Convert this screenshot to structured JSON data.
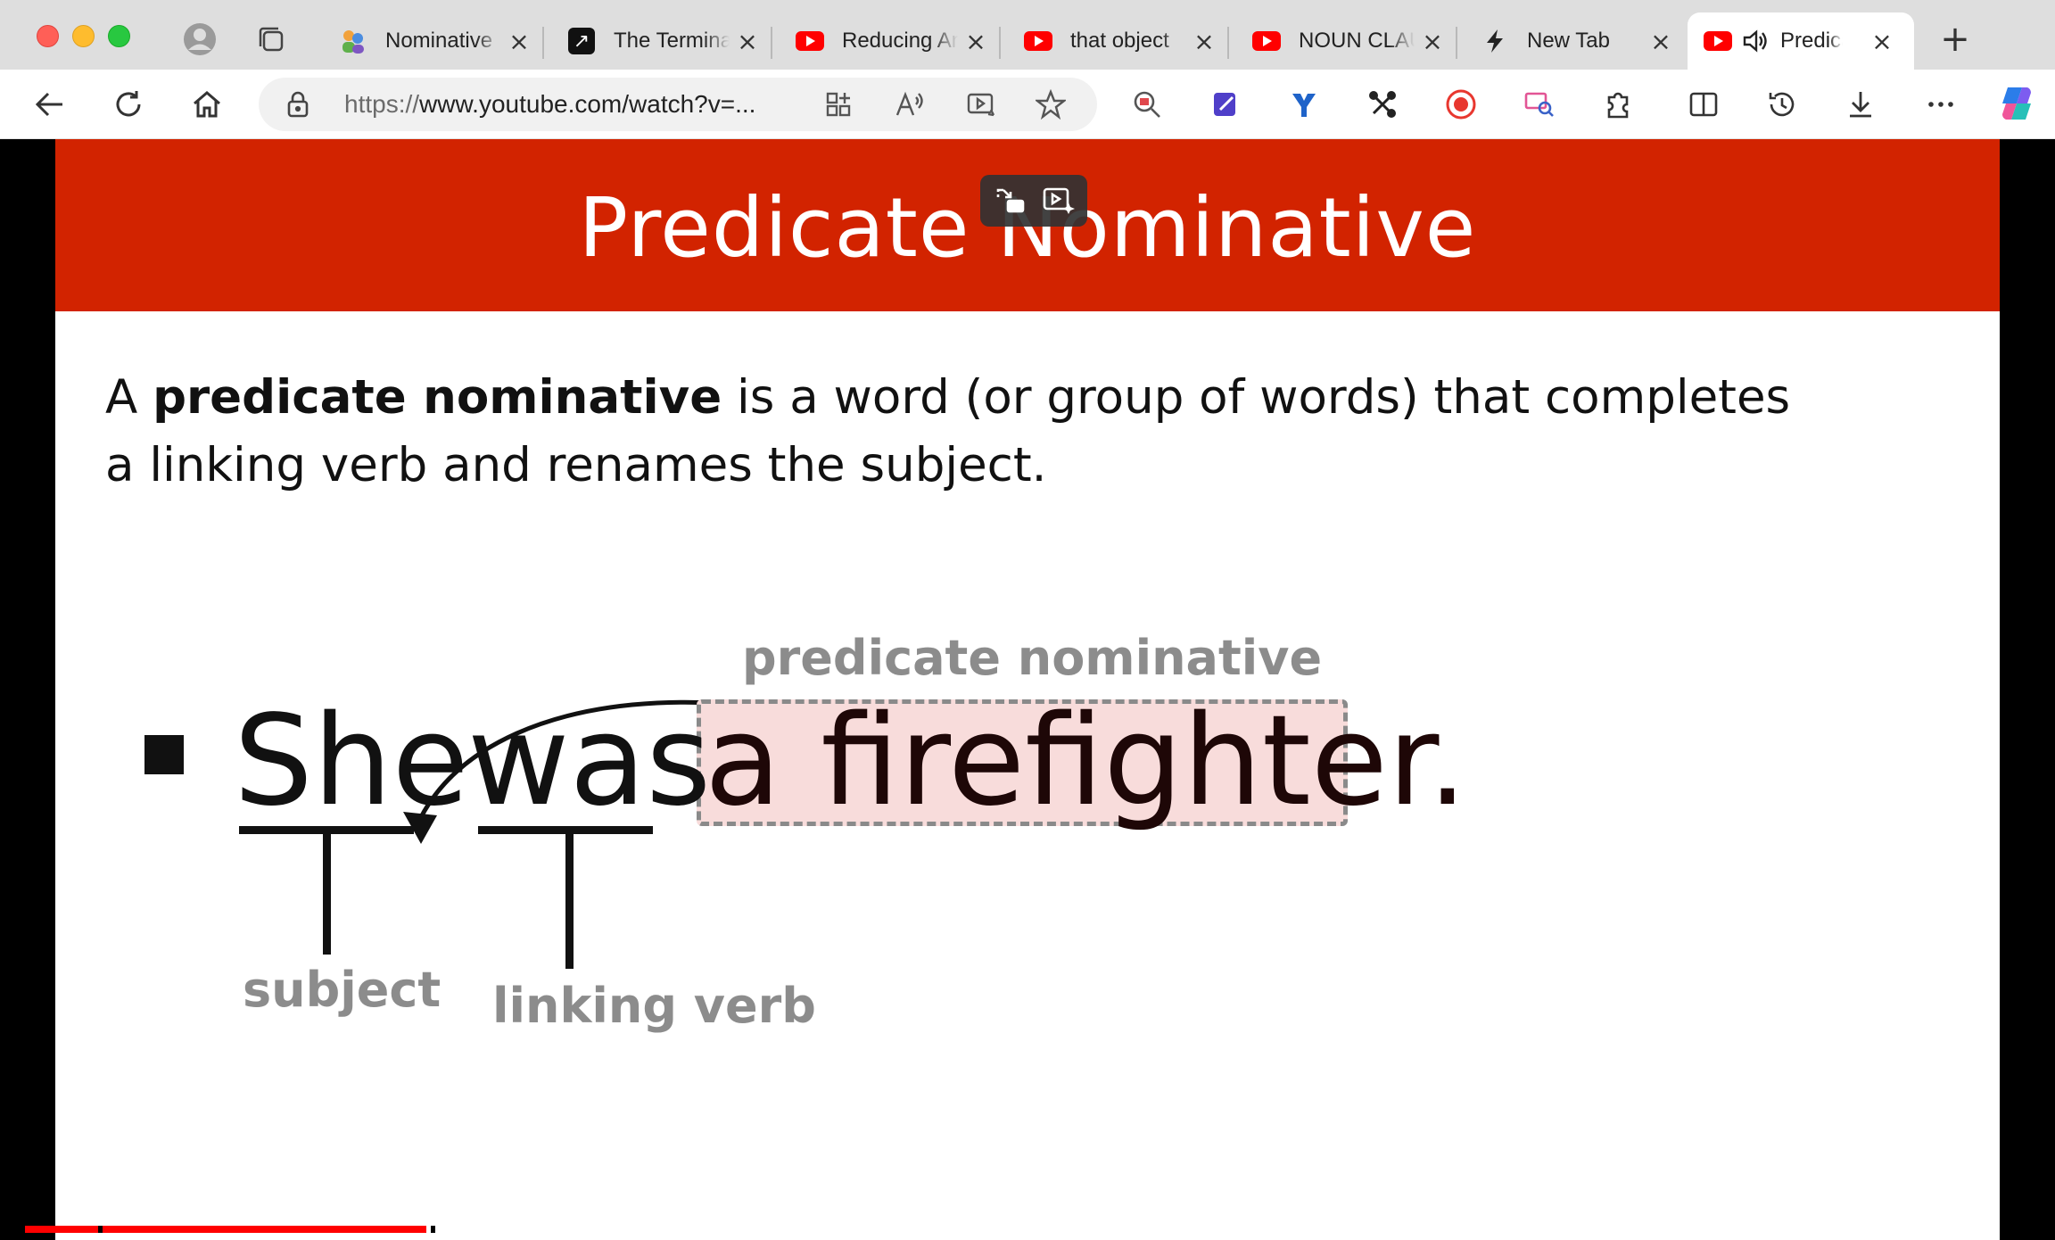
{
  "browser": {
    "tabs": [
      {
        "title": "Nominative",
        "icon": "people-icon"
      },
      {
        "title": "The Terminator",
        "icon": "arrow-link-icon"
      },
      {
        "title": "Reducing Anxiety",
        "icon": "youtube-icon"
      },
      {
        "title": "that object",
        "icon": "youtube-icon"
      },
      {
        "title": "NOUN CLAUSE",
        "icon": "youtube-icon"
      },
      {
        "title": "New Tab",
        "icon": "bolt-icon"
      },
      {
        "title": "Predicate",
        "icon": "youtube-icon",
        "active": true,
        "audio": true
      }
    ],
    "address": {
      "scheme": "https://",
      "rest": "www.youtube.com/watch?v=..."
    }
  },
  "slide": {
    "title": "Predicate Nominative",
    "definition": {
      "prefix": "A ",
      "term": "predicate nominative",
      "suffix": " is a word (or group of words) that completes a linking verb and renames the subject."
    },
    "sentence": {
      "subject": "She",
      "verb": "was",
      "predicate_nominative": "a firefighter."
    },
    "labels": {
      "predicate_nominative": "predicate nominative",
      "subject": "subject",
      "linking_verb": "linking verb"
    }
  },
  "video": {
    "progress_fraction": 0.2
  },
  "colors": {
    "header_red": "#d22300",
    "highlight_pink": "#f8dcdb",
    "progress_red": "#ff0000"
  }
}
